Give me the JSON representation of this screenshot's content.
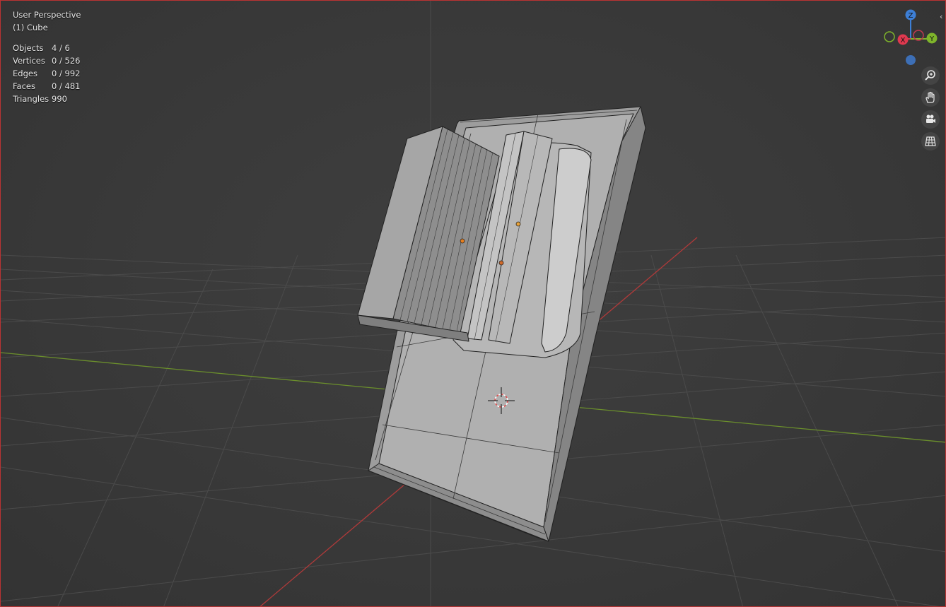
{
  "viewport": {
    "view_name": "User Perspective",
    "active_object": "(1) Cube",
    "stats": [
      {
        "label": "Objects",
        "value": "4 / 6"
      },
      {
        "label": "Vertices",
        "value": "0 / 526"
      },
      {
        "label": "Edges",
        "value": "0 / 992"
      },
      {
        "label": "Faces",
        "value": "0 / 481"
      },
      {
        "label": "Triangles",
        "value": "990"
      }
    ]
  },
  "gizmo": {
    "z_label": "Z",
    "x_label": "X",
    "y_label": "Y",
    "colors": {
      "x": "#e0394f",
      "y": "#7fb52b",
      "z": "#3d7fd6"
    }
  },
  "tools": [
    {
      "name": "zoom-icon"
    },
    {
      "name": "hand-pan-icon"
    },
    {
      "name": "camera-icon"
    },
    {
      "name": "grid-ortho-icon"
    }
  ],
  "colors": {
    "background": "#393939",
    "grid": "#4a4a4a",
    "axis_x": "#b33a3a",
    "axis_y": "#6a8f2a",
    "mesh": "#a9a9a9",
    "origin": "#e78a20",
    "border": "#b33333"
  }
}
